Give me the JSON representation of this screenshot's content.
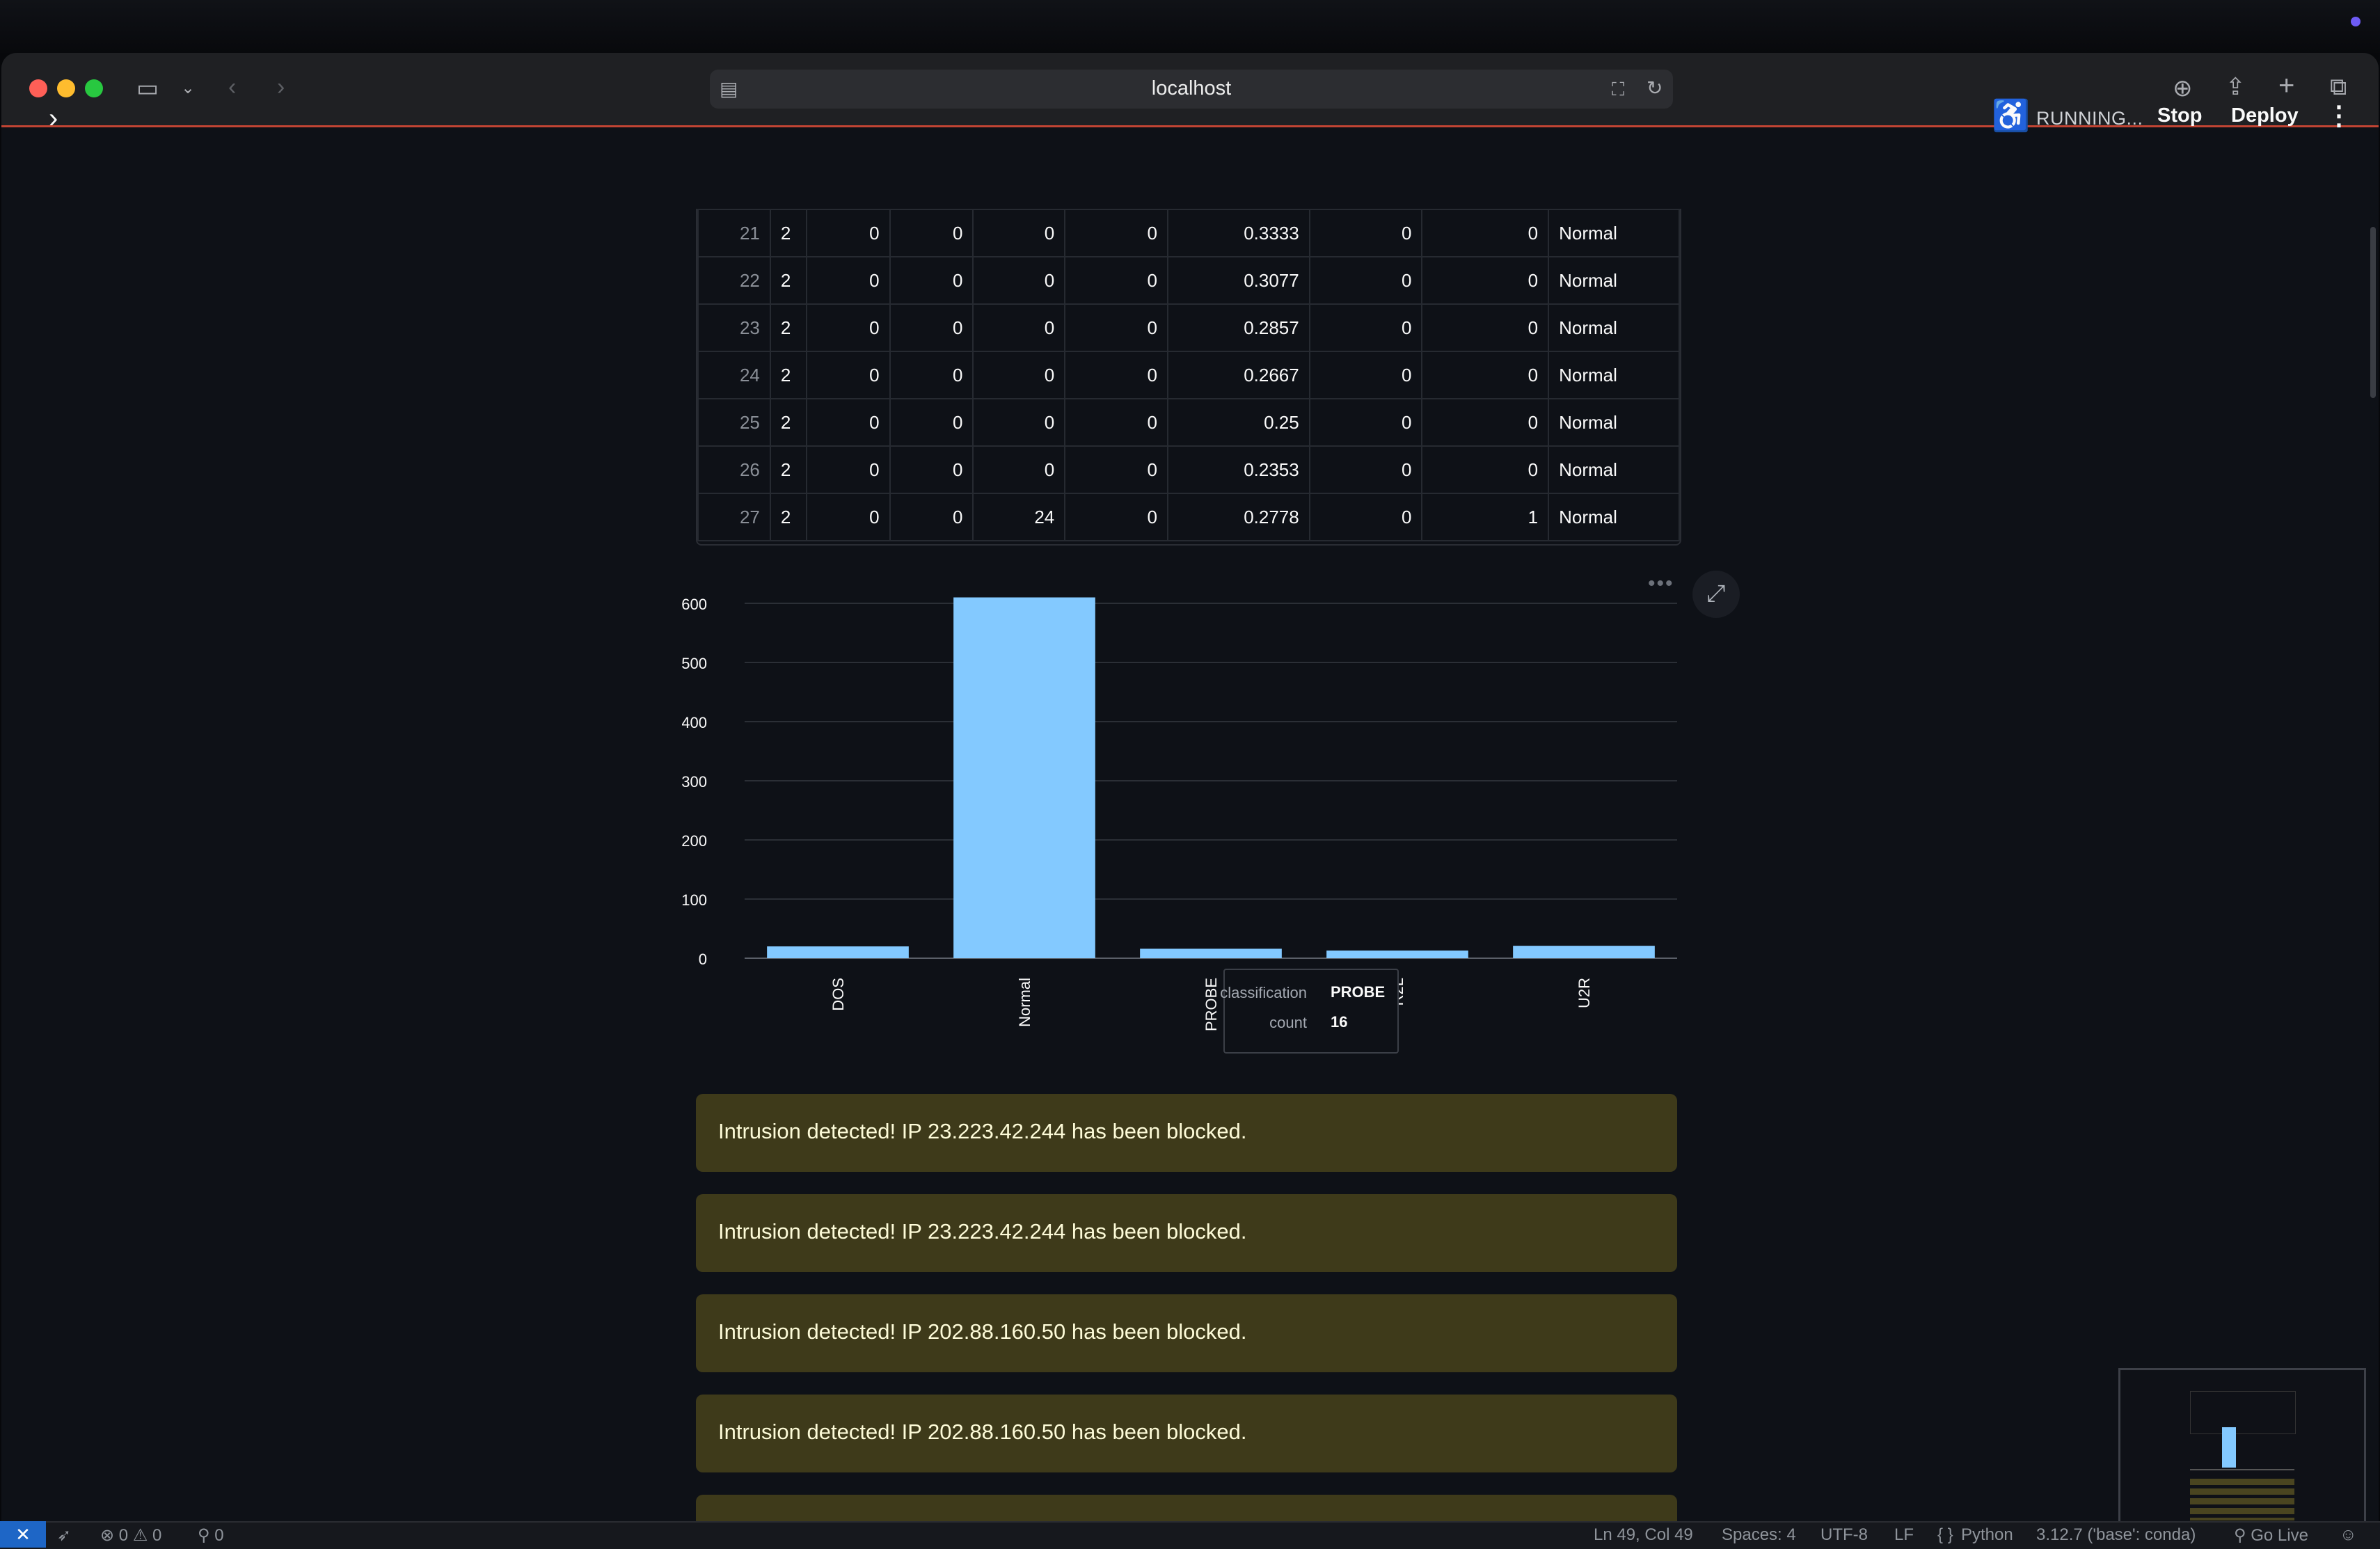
{
  "browser": {
    "url": "localhost"
  },
  "header": {
    "status": "RUNNING...",
    "stop_label": "Stop",
    "deploy_label": "Deploy"
  },
  "table": {
    "rows": [
      [
        "21",
        "2",
        "0",
        "0",
        "0",
        "0",
        "0.3333",
        "0",
        "0",
        "Normal"
      ],
      [
        "22",
        "2",
        "0",
        "0",
        "0",
        "0",
        "0.3077",
        "0",
        "0",
        "Normal"
      ],
      [
        "23",
        "2",
        "0",
        "0",
        "0",
        "0",
        "0.2857",
        "0",
        "0",
        "Normal"
      ],
      [
        "24",
        "2",
        "0",
        "0",
        "0",
        "0",
        "0.2667",
        "0",
        "0",
        "Normal"
      ],
      [
        "25",
        "2",
        "0",
        "0",
        "0",
        "0",
        "0.25",
        "0",
        "0",
        "Normal"
      ],
      [
        "26",
        "2",
        "0",
        "0",
        "0",
        "0",
        "0.2353",
        "0",
        "0",
        "Normal"
      ],
      [
        "27",
        "2",
        "0",
        "0",
        "24",
        "0",
        "0.2778",
        "0",
        "1",
        "Normal"
      ]
    ]
  },
  "chart_data": {
    "type": "bar",
    "categories": [
      "DOS",
      "Normal",
      "PROBE",
      "R2L",
      "U2R"
    ],
    "values": [
      20,
      610,
      16,
      13,
      21
    ],
    "ylim": [
      0,
      620
    ],
    "yticks": [
      0,
      100,
      200,
      300,
      400,
      500,
      600
    ],
    "grid": true,
    "bar_color": "#83c9ff",
    "tooltip": {
      "field1": "classification",
      "value1": "PROBE",
      "field2": "count",
      "value2": "16"
    }
  },
  "alerts": [
    "Intrusion detected! IP 23.223.42.244 has been blocked.",
    "Intrusion detected! IP 23.223.42.244 has been blocked.",
    "Intrusion detected! IP 202.88.160.50 has been blocked.",
    "Intrusion detected! IP 202.88.160.50 has been blocked."
  ],
  "statusbar": {
    "errors": "0",
    "warnings": "0",
    "ports": "0",
    "position": "Ln 49, Col 49",
    "spaces": "Spaces: 4",
    "encoding": "UTF-8",
    "eol": "LF",
    "language": "Python",
    "interpreter": "3.12.7 ('base': conda)",
    "golive": "Go Live"
  }
}
